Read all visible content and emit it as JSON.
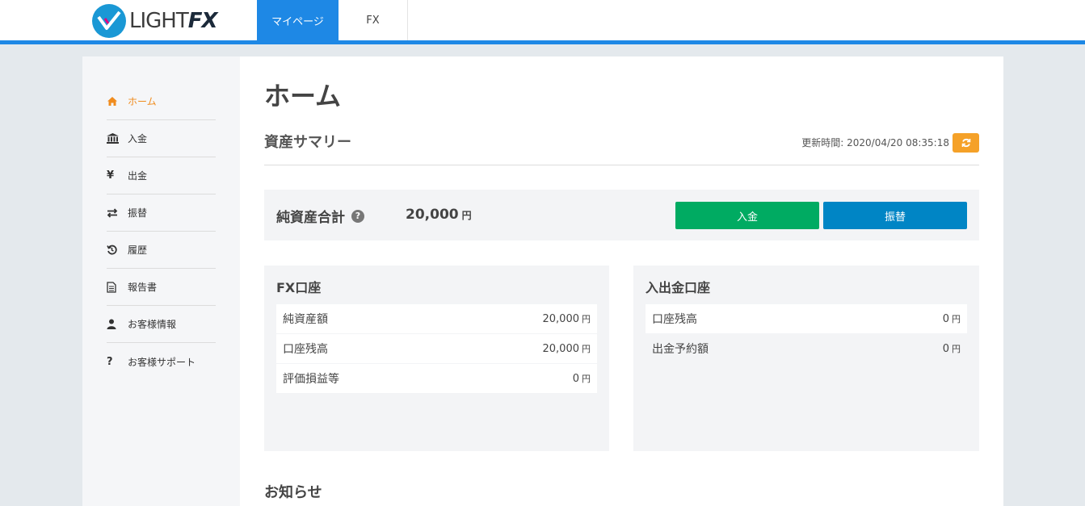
{
  "header": {
    "logo": {
      "text_plain": "LIGHT",
      "text_bold": "FX"
    },
    "tabs": [
      {
        "label": "マイページ",
        "active": true
      },
      {
        "label": "FX",
        "active": false
      }
    ],
    "accent_color": "#1e88e5"
  },
  "sidebar": {
    "items": [
      {
        "label": "ホーム",
        "icon": "home-icon",
        "active": true
      },
      {
        "label": "入金",
        "icon": "bank-icon"
      },
      {
        "label": "出金",
        "icon": "yen-icon"
      },
      {
        "label": "振替",
        "icon": "transfer-icon"
      },
      {
        "label": "履歴",
        "icon": "history-icon"
      },
      {
        "label": "報告書",
        "icon": "document-icon"
      },
      {
        "label": "お客様情報",
        "icon": "user-icon"
      },
      {
        "label": "お客様サポート",
        "icon": "question-icon"
      }
    ],
    "active_color": "#f08c1e"
  },
  "main": {
    "title": "ホーム",
    "summary_section": {
      "title": "資産サマリー",
      "updated_label": "更新時間:",
      "updated_value": "2020/04/20 08:35:18"
    },
    "net_assets": {
      "label": "純資産合計",
      "value": "20,000",
      "unit": "円"
    },
    "buttons": {
      "deposit": "入金",
      "transfer": "振替"
    },
    "fx_account": {
      "title": "FX口座",
      "rows": [
        {
          "label": "純資産額",
          "value": "20,000",
          "unit": "円"
        },
        {
          "label": "口座残高",
          "value": "20,000",
          "unit": "円"
        },
        {
          "label": "評価損益等",
          "value": "0",
          "unit": "円"
        }
      ]
    },
    "bank_account": {
      "title": "入出金口座",
      "rows": [
        {
          "label": "口座残高",
          "value": "0",
          "unit": "円"
        },
        {
          "label": "出金予約額",
          "value": "0",
          "unit": "円"
        }
      ]
    },
    "news": {
      "title": "お知らせ"
    }
  },
  "colors": {
    "deposit_button": "#00ab62",
    "transfer_button": "#0085c5",
    "refresh_button": "#f5a128"
  }
}
